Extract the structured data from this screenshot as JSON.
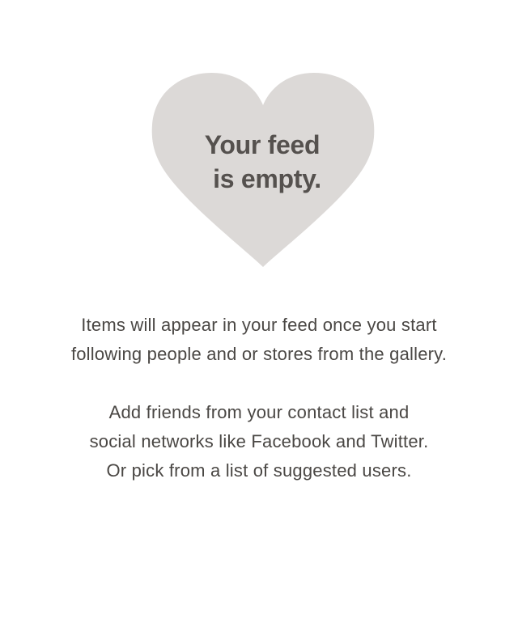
{
  "empty_state": {
    "icon": "heart-icon",
    "heart_color": "#dcd9d7",
    "title_lines": [
      "Your feed",
      "is empty."
    ],
    "paragraph1_lines": [
      "Items will appear in your feed once you start",
      "following people and or stores from the gallery."
    ],
    "paragraph2_lines": [
      "Add friends from your contact list and",
      "social networks like Facebook and Twitter.",
      "Or pick from a list of suggested users."
    ]
  }
}
